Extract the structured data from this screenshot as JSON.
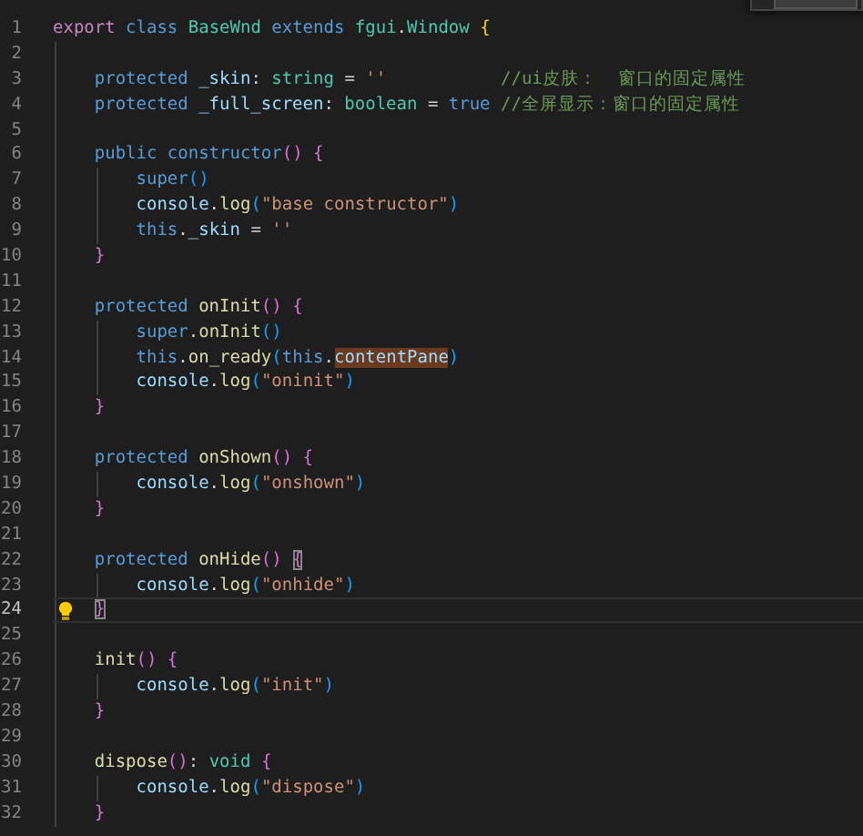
{
  "lines": [
    {
      "number": "1",
      "active": false,
      "lightbulb": false,
      "tokens": [
        {
          "text": "export ",
          "kind": "ctl"
        },
        {
          "text": "class ",
          "kind": "kw"
        },
        {
          "text": "BaseWnd ",
          "kind": "type"
        },
        {
          "text": "extends ",
          "kind": "kw"
        },
        {
          "text": "fgui",
          "kind": "type"
        },
        {
          "text": ".",
          "kind": "plain"
        },
        {
          "text": "Window ",
          "kind": "type"
        },
        {
          "text": "{",
          "kind": "br1"
        }
      ]
    },
    {
      "number": "2",
      "active": false
    },
    {
      "number": "3",
      "active": false,
      "lightbulb": false,
      "tokens": [
        {
          "text": "    protected ",
          "kind": "kw"
        },
        {
          "text": "_skin",
          "kind": "var"
        },
        {
          "text": ": ",
          "kind": "plain"
        },
        {
          "text": "string",
          "kind": "type"
        },
        {
          "text": " = ",
          "kind": "plain"
        },
        {
          "text": "''           ",
          "kind": "str"
        },
        {
          "text": "//ui皮肤：  窗口的固定属性",
          "kind": "cmt"
        }
      ]
    },
    {
      "number": "4",
      "active": false,
      "lightbulb": false,
      "tokens": [
        {
          "text": "    protected ",
          "kind": "kw"
        },
        {
          "text": "_full_screen",
          "kind": "var"
        },
        {
          "text": ": ",
          "kind": "plain"
        },
        {
          "text": "boolean",
          "kind": "type"
        },
        {
          "text": " = ",
          "kind": "plain"
        },
        {
          "text": "true ",
          "kind": "kw"
        },
        {
          "text": "//全屏显示：窗口的固定属性",
          "kind": "cmt"
        }
      ]
    },
    {
      "number": "5",
      "active": false
    },
    {
      "number": "6",
      "active": false,
      "lightbulb": false,
      "tokens": [
        {
          "text": "    public ",
          "kind": "kw"
        },
        {
          "text": "constructor",
          "kind": "kw"
        },
        {
          "text": "() {",
          "kind": "br2"
        }
      ]
    },
    {
      "number": "7",
      "active": false,
      "lightbulb": false,
      "tokens": [
        {
          "text": "        super",
          "kind": "kw"
        },
        {
          "text": "()",
          "kind": "br3"
        }
      ]
    },
    {
      "number": "8",
      "active": false,
      "lightbulb": false,
      "tokens": [
        {
          "text": "        console",
          "kind": "var"
        },
        {
          "text": ".",
          "kind": "plain"
        },
        {
          "text": "log",
          "kind": "fn"
        },
        {
          "text": "(",
          "kind": "br3"
        },
        {
          "text": "\"base constructor\"",
          "kind": "str"
        },
        {
          "text": ")",
          "kind": "br3"
        }
      ]
    },
    {
      "number": "9",
      "active": false,
      "lightbulb": false,
      "tokens": [
        {
          "text": "        this",
          "kind": "kw"
        },
        {
          "text": ".",
          "kind": "plain"
        },
        {
          "text": "_skin",
          "kind": "var"
        },
        {
          "text": " = ",
          "kind": "plain"
        },
        {
          "text": "''",
          "kind": "str"
        }
      ]
    },
    {
      "number": "10",
      "active": false,
      "lightbulb": false,
      "tokens": [
        {
          "text": "    }",
          "kind": "br2"
        }
      ]
    },
    {
      "number": "11",
      "active": false
    },
    {
      "number": "12",
      "active": false,
      "lightbulb": false,
      "tokens": [
        {
          "text": "    protected ",
          "kind": "kw"
        },
        {
          "text": "onInit",
          "kind": "fn"
        },
        {
          "text": "() {",
          "kind": "br2"
        }
      ]
    },
    {
      "number": "13",
      "active": false,
      "lightbulb": false,
      "tokens": [
        {
          "text": "        super",
          "kind": "kw"
        },
        {
          "text": ".",
          "kind": "plain"
        },
        {
          "text": "onInit",
          "kind": "fn"
        },
        {
          "text": "()",
          "kind": "br3"
        }
      ]
    },
    {
      "number": "14",
      "active": false,
      "lightbulb": false,
      "tokens": [
        {
          "text": "        this",
          "kind": "kw"
        },
        {
          "text": ".",
          "kind": "plain"
        },
        {
          "text": "on_ready",
          "kind": "fn"
        },
        {
          "text": "(",
          "kind": "br3"
        },
        {
          "text": "this",
          "kind": "kw"
        },
        {
          "text": ".",
          "kind": "plain"
        },
        {
          "text": "contentPane",
          "kind": "var",
          "highlighted": true
        },
        {
          "text": ")",
          "kind": "br3"
        }
      ]
    },
    {
      "number": "15",
      "active": false,
      "lightbulb": false,
      "tokens": [
        {
          "text": "        console",
          "kind": "var"
        },
        {
          "text": ".",
          "kind": "plain"
        },
        {
          "text": "log",
          "kind": "fn"
        },
        {
          "text": "(",
          "kind": "br3"
        },
        {
          "text": "\"oninit\"",
          "kind": "str"
        },
        {
          "text": ")",
          "kind": "br3"
        }
      ]
    },
    {
      "number": "16",
      "active": false,
      "lightbulb": false,
      "tokens": [
        {
          "text": "    }",
          "kind": "br2"
        }
      ]
    },
    {
      "number": "17",
      "active": false
    },
    {
      "number": "18",
      "active": false,
      "lightbulb": false,
      "tokens": [
        {
          "text": "    protected ",
          "kind": "kw"
        },
        {
          "text": "onShown",
          "kind": "fn"
        },
        {
          "text": "() {",
          "kind": "br2"
        }
      ]
    },
    {
      "number": "19",
      "active": false,
      "lightbulb": false,
      "tokens": [
        {
          "text": "        console",
          "kind": "var"
        },
        {
          "text": ".",
          "kind": "plain"
        },
        {
          "text": "log",
          "kind": "fn"
        },
        {
          "text": "(",
          "kind": "br3"
        },
        {
          "text": "\"onshown\"",
          "kind": "str"
        },
        {
          "text": ")",
          "kind": "br3"
        }
      ]
    },
    {
      "number": "20",
      "active": false,
      "lightbulb": false,
      "tokens": [
        {
          "text": "    }",
          "kind": "br2"
        }
      ]
    },
    {
      "number": "21",
      "active": false
    },
    {
      "number": "22",
      "active": false,
      "lightbulb": false,
      "tokens": [
        {
          "text": "    protected ",
          "kind": "kw"
        },
        {
          "text": "onHide",
          "kind": "fn"
        },
        {
          "text": "() ",
          "kind": "br2"
        },
        {
          "text": "{",
          "kind": "br2",
          "boxed": true
        }
      ]
    },
    {
      "number": "23",
      "active": false,
      "lightbulb": false,
      "tokens": [
        {
          "text": "        console",
          "kind": "var"
        },
        {
          "text": ".",
          "kind": "plain"
        },
        {
          "text": "log",
          "kind": "fn"
        },
        {
          "text": "(",
          "kind": "br3"
        },
        {
          "text": "\"onhide\"",
          "kind": "str"
        },
        {
          "text": ")",
          "kind": "br3"
        }
      ]
    },
    {
      "number": "24",
      "active": true,
      "lightbulb": true,
      "tokens": [
        {
          "text": "    }",
          "kind": "br2",
          "boxed": true
        }
      ]
    },
    {
      "number": "25",
      "active": false
    },
    {
      "number": "26",
      "active": false,
      "lightbulb": false,
      "tokens": [
        {
          "text": "    init",
          "kind": "fn"
        },
        {
          "text": "() {",
          "kind": "br2"
        }
      ]
    },
    {
      "number": "27",
      "active": false,
      "lightbulb": false,
      "tokens": [
        {
          "text": "        console",
          "kind": "var"
        },
        {
          "text": ".",
          "kind": "plain"
        },
        {
          "text": "log",
          "kind": "fn"
        },
        {
          "text": "(",
          "kind": "br3"
        },
        {
          "text": "\"init\"",
          "kind": "str"
        },
        {
          "text": ")",
          "kind": "br3"
        }
      ]
    },
    {
      "number": "28",
      "active": false,
      "lightbulb": false,
      "tokens": [
        {
          "text": "    }",
          "kind": "br2"
        }
      ]
    },
    {
      "number": "29",
      "active": false
    },
    {
      "number": "30",
      "active": false,
      "lightbulb": false,
      "tokens": [
        {
          "text": "    dispose",
          "kind": "fn"
        },
        {
          "text": "()",
          "kind": "br2"
        },
        {
          "text": ": ",
          "kind": "plain"
        },
        {
          "text": "void",
          "kind": "type"
        },
        {
          "text": " {",
          "kind": "br2"
        }
      ]
    },
    {
      "number": "31",
      "active": false,
      "lightbulb": false,
      "tokens": [
        {
          "text": "        console",
          "kind": "var"
        },
        {
          "text": ".",
          "kind": "plain"
        },
        {
          "text": "log",
          "kind": "fn"
        },
        {
          "text": "(",
          "kind": "br3"
        },
        {
          "text": "\"dispose\"",
          "kind": "str"
        },
        {
          "text": ")",
          "kind": "br3"
        }
      ]
    },
    {
      "number": "32",
      "active": false,
      "lightbulb": false,
      "tokens": [
        {
          "text": "    }",
          "kind": "br2"
        }
      ]
    }
  ]
}
